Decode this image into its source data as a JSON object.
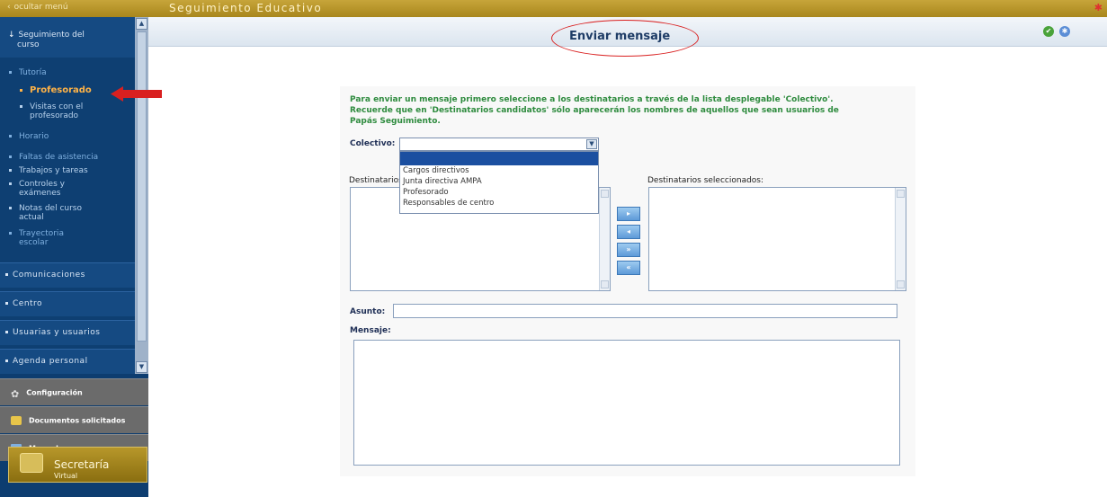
{
  "topbar": {
    "hide_menu": "ocultar menú",
    "app_title": "Seguimiento Educativo"
  },
  "sidebar": {
    "course_section": [
      "Seguimiento del",
      "curso"
    ],
    "tutoria": "Tutoría",
    "profesorado": "Profesorado",
    "visitas": [
      "Visitas con el",
      "profesorado"
    ],
    "horario": "Horario",
    "faltas": "Faltas de asistencia",
    "trabajos": "Trabajos y tareas",
    "controles": [
      "Controles y",
      "exámenes"
    ],
    "notas": [
      "Notas del curso",
      "actual"
    ],
    "trayectoria": [
      "Trayectoria",
      "escolar"
    ],
    "comunicaciones": "Comunicaciones",
    "centro": "Centro",
    "usuarios": "Usuarias y usuarios",
    "agenda": "Agenda personal",
    "configuracion": "Configuración",
    "documentos": "Documentos solicitados",
    "manuales": "Manuales",
    "secretaria": "Secretaría",
    "secretaria_sub": "Virtual"
  },
  "header": {
    "title": "Enviar mensaje"
  },
  "form": {
    "intro": [
      "Para enviar un mensaje primero seleccione a los destinatarios a través de la lista desplegable 'Colectivo'.",
      "Recuerde que en 'Destinatarios candidatos' sólo aparecerán los nombres de aquellos que sean usuarios de",
      "Papás Seguimiento."
    ],
    "colectivo_label": "Colectivo:",
    "colectivo_value": "",
    "colectivo_options": [
      "Cargos directivos",
      "Junta directiva AMPA",
      "Profesorado",
      "Responsables de centro"
    ],
    "candidatos_label": "Destinatarios",
    "seleccionados_label": "Destinatarios seleccionados:",
    "move_buttons": [
      "▸",
      "◂",
      "»",
      "«"
    ],
    "asunto_label": "Asunto:",
    "mensaje_label": "Mensaje:"
  },
  "colors": {
    "sidebar": "#0d3d70",
    "topbar": "#b8962a",
    "intro_text": "#2e8b3e",
    "active_item": "#ffb347",
    "highlight_option": "#1b4fa0",
    "annotation": "#d92020"
  }
}
